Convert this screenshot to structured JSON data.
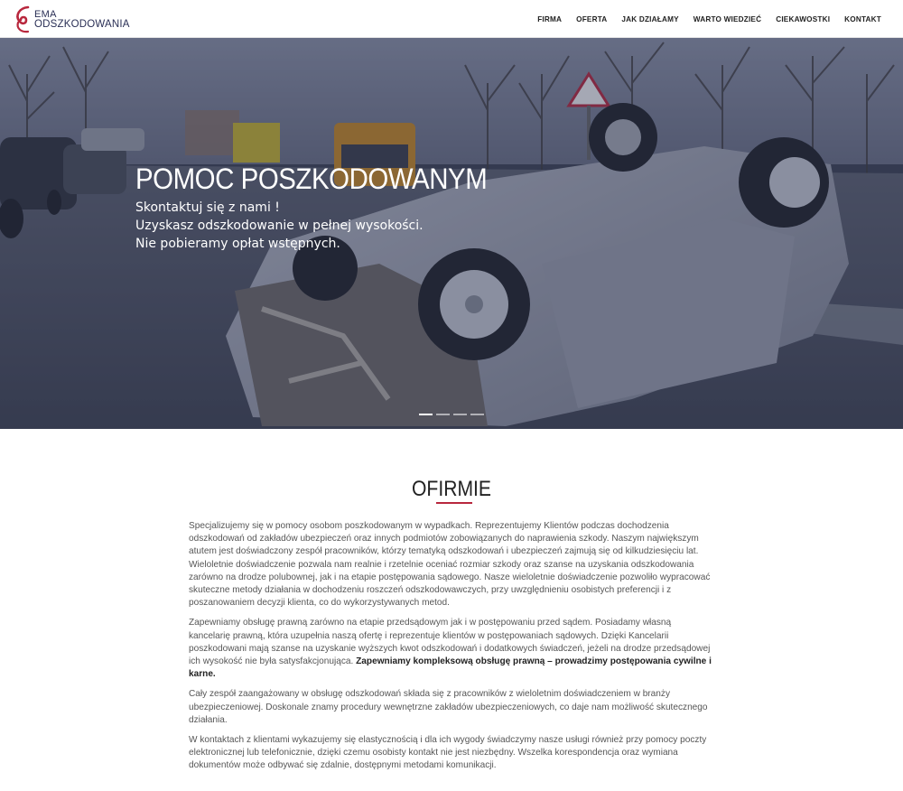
{
  "logo": {
    "line1": "EMA",
    "line2": "ODSZKODOWANIA"
  },
  "nav": [
    "FIRMA",
    "OFERTA",
    "JAK DZIAŁAMY",
    "WARTO WIEDZIEĆ",
    "CIEKAWOSTKI",
    "KONTAKT"
  ],
  "hero": {
    "title": "POMOC POSZKODOWANYM",
    "lines": [
      "Skontaktuj się z nami !",
      "Uzyskasz odszkodowanie w pełnej wysokości.",
      "Nie pobieramy opłat wstępnych."
    ],
    "slide_count": 4,
    "active_slide": 1
  },
  "about": {
    "title_part1": "O ",
    "title_part2": "FIRMIE",
    "p1": "Specjalizujemy się w pomocy osobom poszkodowanym w wypadkach. Reprezentujemy Klientów podczas dochodzenia odszkodowań od zakładów ubezpieczeń oraz innych podmiotów zobowiązanych do naprawienia szkody. Naszym największym atutem jest doświadczony zespół pracowników, którzy tematyką odszkodowań i ubezpieczeń zajmują się od kilkudziesięciu lat. Wieloletnie doświadczenie pozwala nam realnie i rzetelnie oceniać rozmiar szkody oraz szanse na uzyskania odszkodowania zarówno na drodze polubownej, jak i na etapie postępowania sądowego. Nasze wieloletnie doświadczenie pozwoliło wypracować skuteczne metody działania w dochodzeniu roszczeń odszkodowawczych, przy uwzględnieniu osobistych preferencji i z poszanowaniem decyzji klienta, co do wykorzystywanych metod.",
    "p2": "Zapewniamy obsługę prawną zarówno na etapie przedsądowym jak i w postępowaniu przed sądem. Posiadamy własną kancelarię prawną, która uzupełnia naszą ofertę i reprezentuje klientów w postępowaniach sądowych. Dzięki Kancelarii poszkodowani mają szanse na uzyskanie wyższych kwot odszkodowań i dodatkowych świadczeń, jeżeli na drodze przedsądowej ich wysokość nie była satysfakcjonująca. ",
    "p2_bold": "Zapewniamy kompleksową obsługę prawną – prowadzimy postępowania cywilne i karne.",
    "p3": "Cały zespół zaangażowany w obsługę odszkodowań składa się z pracowników z wieloletnim doświadczeniem w branży ubezpieczeniowej. Doskonale znamy procedury wewnętrzne zakładów ubezpieczeniowych, co daje nam możliwość skutecznego działania.",
    "p4": "W kontaktach z klientami wykazujemy się elastycznością i dla ich wygody świadczymy nasze usługi również przy pomocy poczty elektronicznej lub telefonicznie, dzięki czemu osobisty kontakt nie jest niezbędny. Wszelka korespondencja oraz wymiana dokumentów może odbywać się zdalnie, dostępnymi metodami komunikacji."
  },
  "colors": {
    "accent": "#b8273d",
    "brand_navy": "#2a2f55"
  }
}
